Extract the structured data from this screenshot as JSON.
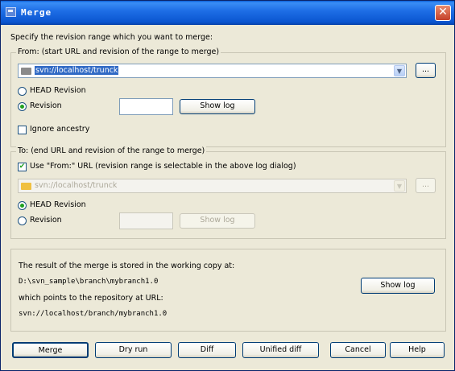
{
  "window": {
    "title": "Merge",
    "close_label": "✕"
  },
  "intro": "Specify the revision range which you want to merge:",
  "from": {
    "legend": "From: (start URL and revision of the range to merge)",
    "url": "svn://localhost/trunck",
    "head_label": "HEAD Revision",
    "revision_label": "Revision",
    "revision_value": "",
    "show_log": "Show log",
    "ignore_ancestry": "Ignore ancestry",
    "browse": "..."
  },
  "to": {
    "legend": "To: (end URL and revision of the range to merge)",
    "use_from_label": "Use \"From:\" URL (revision range is selectable in the above log dialog)",
    "url": "svn://localhost/trunck",
    "head_label": "HEAD Revision",
    "revision_label": "Revision",
    "revision_value": "",
    "show_log": "Show log",
    "browse": "..."
  },
  "info": {
    "line1": "The result of the merge is stored in the working copy at:",
    "line2": "D:\\svn_sample\\branch\\mybranch1.0",
    "line3": "which points to the repository at URL:",
    "line4": "svn://localhost/branch/mybranch1.0",
    "show_log": "Show log"
  },
  "buttons": {
    "merge": "Merge",
    "dry_run": "Dry run",
    "diff": "Diff",
    "unified_diff": "Unified diff",
    "cancel": "Cancel",
    "help": "Help"
  }
}
